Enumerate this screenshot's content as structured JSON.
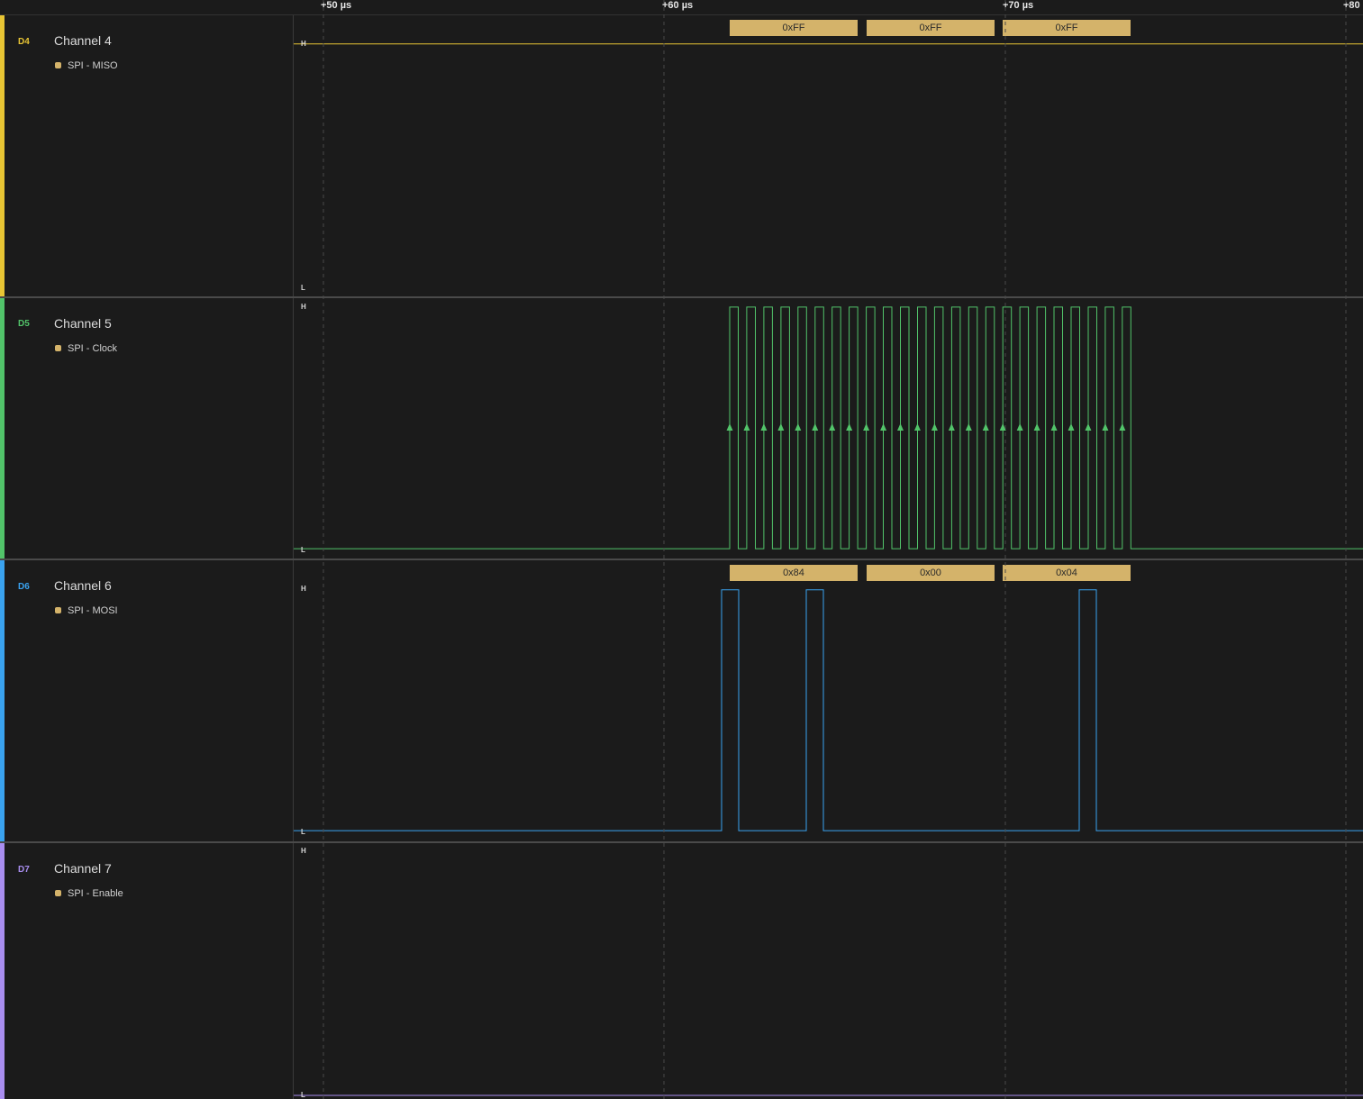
{
  "ruler": {
    "labels": [
      "+50 µs",
      "+60 µs",
      "+70 µs",
      "+80"
    ]
  },
  "level_labels": {
    "high": "H",
    "low": "L"
  },
  "colors": {
    "channel4": "#e8c534",
    "channel5": "#52c46a",
    "channel6": "#3aa3f0",
    "channel7": "#a98ef0",
    "decode": "#d4b36a",
    "background": "#1b1b1b"
  },
  "channels": [
    {
      "id": "D4",
      "name": "Channel 4",
      "analyzer": "SPI - MISO"
    },
    {
      "id": "D5",
      "name": "Channel 5",
      "analyzer": "SPI - Clock"
    },
    {
      "id": "D6",
      "name": "Channel 6",
      "analyzer": "SPI - MOSI"
    },
    {
      "id": "D7",
      "name": "Channel 7",
      "analyzer": "SPI - Enable"
    }
  ],
  "decodes": {
    "miso": [
      "0xFF",
      "0xFF",
      "0xFF"
    ],
    "mosi": [
      "0x84",
      "0x00",
      "0x04"
    ]
  }
}
